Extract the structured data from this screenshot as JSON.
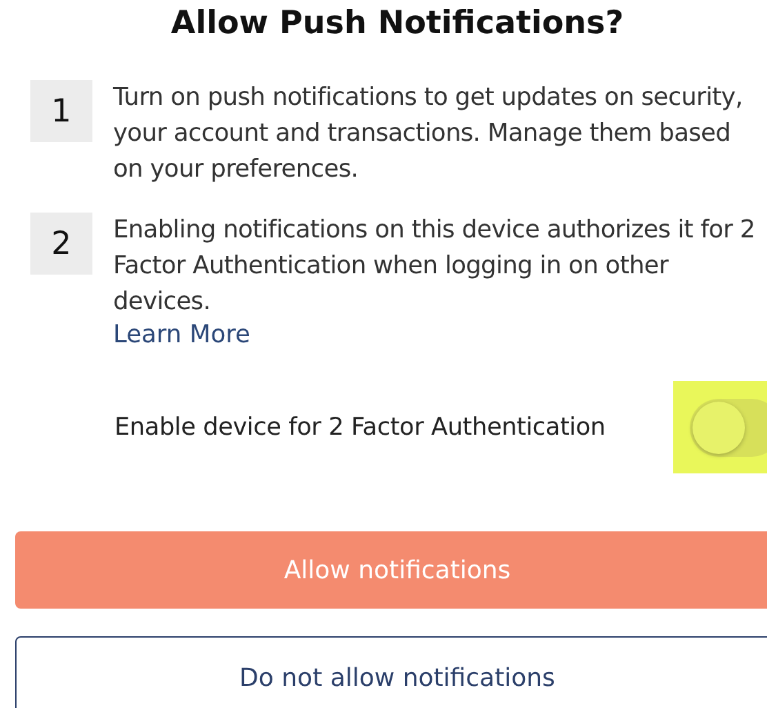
{
  "title": "Allow Push Notifications?",
  "steps": [
    {
      "number": "1",
      "text": "Turn on push notifications to get updates on security, your account and transactions. Manage them based on your preferences."
    },
    {
      "number": "2",
      "text": "Enabling notifications on this device authorizes it for 2 Factor Authentication when logging in on other devices.",
      "link": "Learn More"
    }
  ],
  "toggle": {
    "label": "Enable device for 2 Factor Authentication",
    "on": false,
    "highlighted": true
  },
  "buttons": [
    {
      "kind": "primary",
      "label": "Allow notifications"
    },
    {
      "kind": "secondary",
      "label": "Do not allow notifications"
    }
  ]
}
